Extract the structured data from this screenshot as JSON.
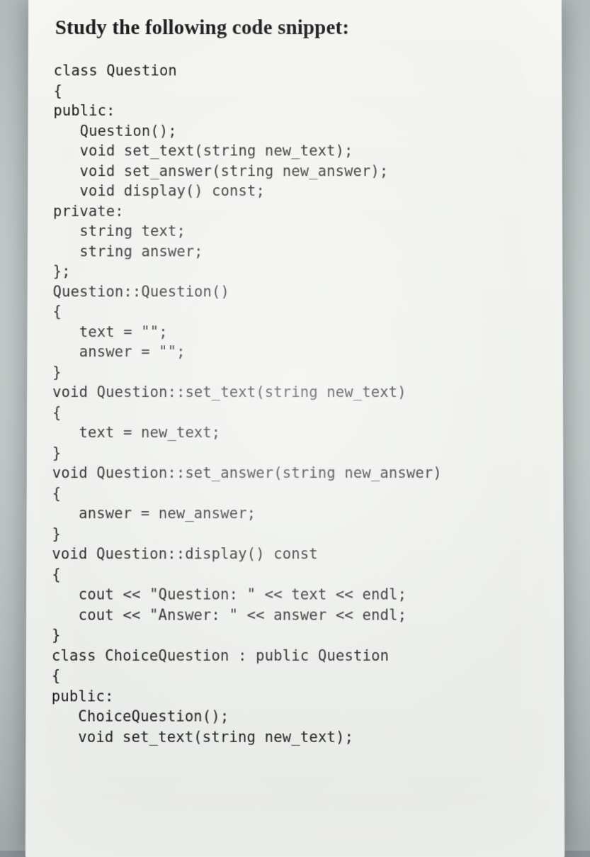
{
  "heading": "Study the following code snippet:",
  "code_lines": [
    "class Question",
    "{",
    "public:",
    "   Question();",
    "   void set_text(string new_text);",
    "   void set_answer(string new_answer);",
    "   void display() const;",
    "private:",
    "   string text;",
    "   string answer;",
    "};",
    "Question::Question()",
    "{",
    "   text = \"\";",
    "   answer = \"\";",
    "}",
    "void Question::set_text(string new_text)",
    "{",
    "   text = new_text;",
    "}",
    "void Question::set_answer(string new_answer)",
    "{",
    "   answer = new_answer;",
    "}",
    "void Question::display() const",
    "{",
    "   cout << \"Question: \" << text << endl;",
    "   cout << \"Answer: \" << answer << endl;",
    "}",
    "class ChoiceQuestion : public Question",
    "{",
    "public:",
    "   ChoiceQuestion();",
    "   void set_text(string new_text);"
  ]
}
